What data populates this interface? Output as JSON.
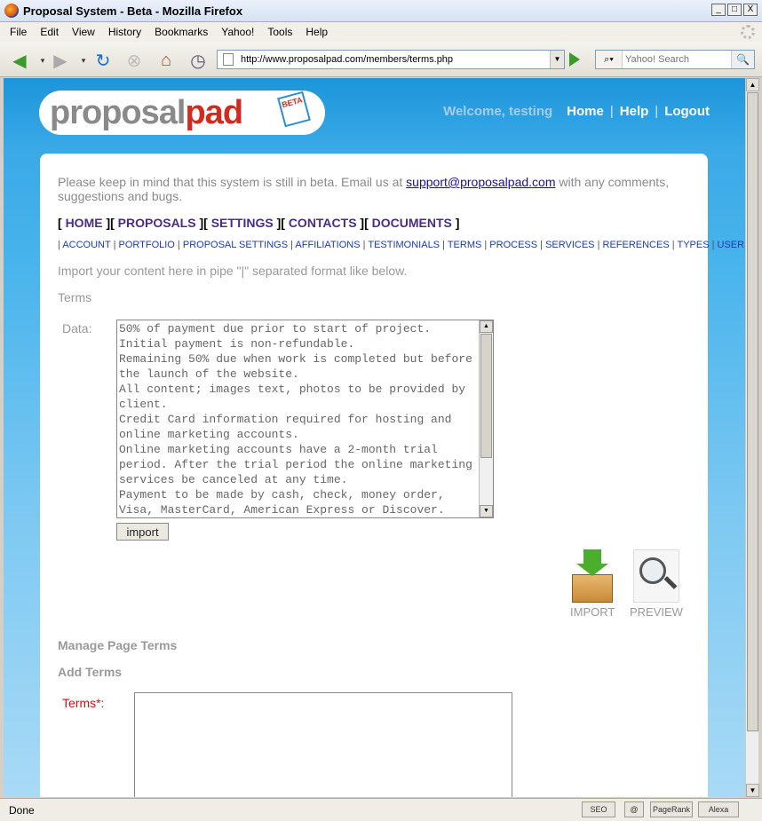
{
  "window": {
    "title": "Proposal System - Beta - Mozilla Firefox",
    "buttons": [
      "_",
      "□",
      "X"
    ]
  },
  "menu": [
    "File",
    "Edit",
    "View",
    "History",
    "Bookmarks",
    "Yahoo!",
    "Tools",
    "Help"
  ],
  "toolbar": {
    "url": "http://www.proposalpad.com/members/terms.php",
    "search_placeholder": "Yahoo! Search"
  },
  "header": {
    "logo_gray": "proposal",
    "logo_red": "pad",
    "logo_badge": "BETA",
    "welcome": "Welcome, testing",
    "links": [
      "Home",
      "Help",
      "Logout"
    ]
  },
  "beta_note": {
    "before": "Please keep in mind that this system is still in beta. Email us at ",
    "email": "support@proposalpad.com",
    "after": " with any comments, suggestions and bugs."
  },
  "main_nav": [
    "HOME",
    "PROPOSALS",
    "SETTINGS",
    "CONTACTS",
    "DOCUMENTS"
  ],
  "sub_nav": [
    "ACCOUNT",
    "PORTFOLIO",
    "PROPOSAL SETTINGS",
    "AFFILIATIONS",
    "TESTIMONIALS",
    "TERMS",
    "PROCESS",
    "SERVICES",
    "REFERENCES",
    "TYPES",
    "USERS"
  ],
  "import_section": {
    "intro": "Import your content here in pipe \"|\" separated format like below.",
    "label": "Terms",
    "data_label": "Data:",
    "data_value": "50% of payment due prior to start of project.\nInitial payment is non-refundable.\nRemaining 50% due when work is completed but before the launch of the website.\nAll content; images text, photos to be provided by client.\nCredit Card information required for hosting and online marketing accounts.\nOnline marketing accounts have a 2-month trial period. After the trial period the online marketing services be canceled at any time.\nPayment to be made by cash, check, money order, Visa, MasterCard, American Express or Discover.",
    "import_button": "import"
  },
  "actions": {
    "import_label": "IMPORT",
    "preview_label": "PREVIEW"
  },
  "manage": {
    "title": "Manage Page Terms",
    "add_title": "Add Terms",
    "terms_label": "Terms*:"
  },
  "status": {
    "text": "Done",
    "seo": "SEO",
    "pagerank": "PageRank",
    "alexa": "Alexa"
  }
}
